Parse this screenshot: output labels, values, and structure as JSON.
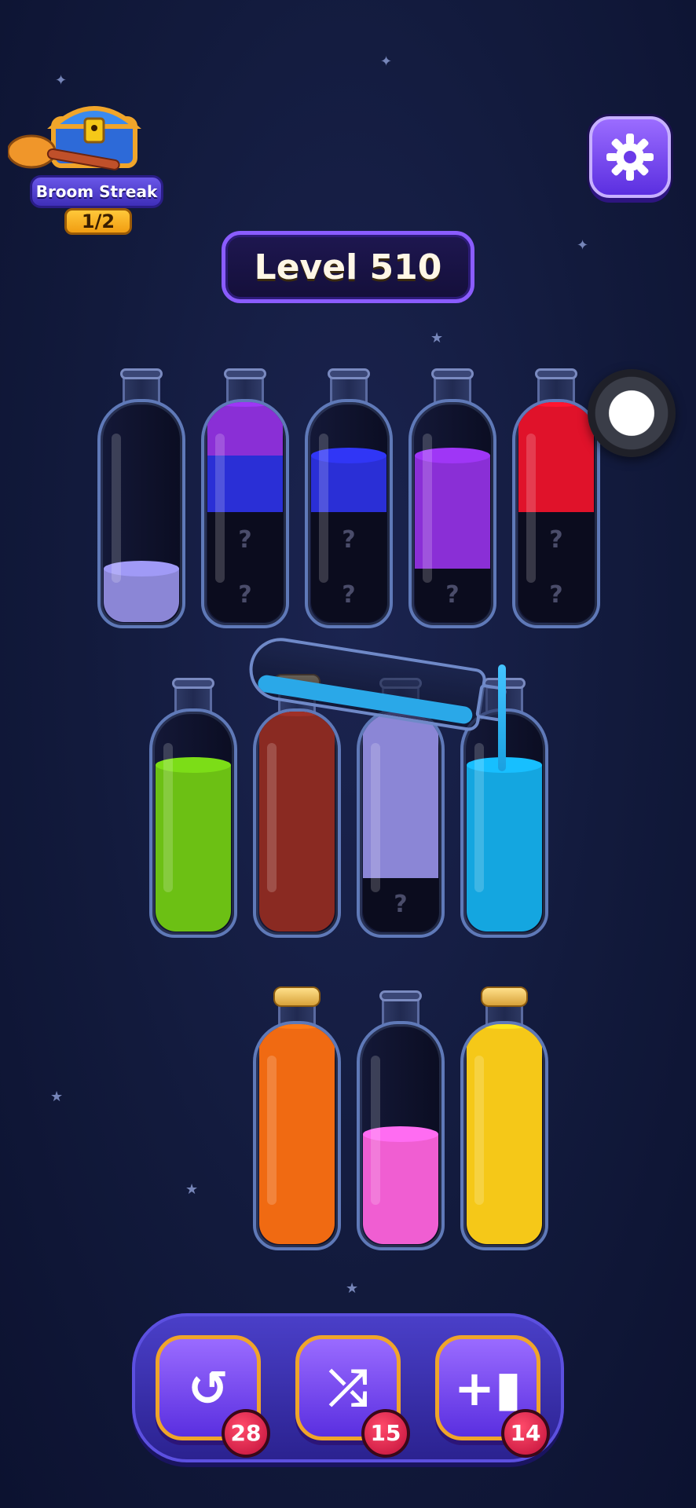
{
  "streak": {
    "label": "Broom Streak",
    "count": "1/2"
  },
  "level": {
    "label": "Level 510"
  },
  "hidden_marker": "?",
  "colors": {
    "lavender": "#8b86d6",
    "purple": "#8a2fd6",
    "blue": "#2a2fd6",
    "red": "#e0122a",
    "green": "#6cc014",
    "brown": "#8a2a22",
    "cyan": "#14a6e0",
    "orange": "#f06a12",
    "pink": "#f05ed2",
    "yellow": "#f5c818"
  },
  "bottles": [
    {
      "corked": false,
      "layers": [
        {
          "color": "lavender",
          "units": 1
        }
      ]
    },
    {
      "corked": false,
      "layers": [
        {
          "hidden": true
        },
        {
          "hidden": true
        },
        {
          "color": "blue",
          "units": 1
        },
        {
          "color": "purple",
          "units": 1
        }
      ]
    },
    {
      "corked": false,
      "layers": [
        {
          "hidden": true
        },
        {
          "hidden": true
        },
        {
          "color": "blue",
          "units": 1
        }
      ]
    },
    {
      "corked": false,
      "layers": [
        {
          "hidden": true
        },
        {
          "color": "purple",
          "units": 2
        }
      ]
    },
    {
      "corked": false,
      "layers": [
        {
          "hidden": true
        },
        {
          "hidden": true
        },
        {
          "color": "red",
          "units": 2
        }
      ]
    },
    {
      "corked": false,
      "layers": [
        {
          "color": "green",
          "units": 3
        }
      ]
    },
    {
      "corked": true,
      "layers": [
        {
          "color": "brown",
          "units": 4
        }
      ]
    },
    {
      "corked": false,
      "layers": [
        {
          "hidden": true
        },
        {
          "color": "lavender",
          "units": 3
        }
      ]
    },
    {
      "corked": false,
      "layers": [
        {
          "color": "cyan",
          "units": 3
        }
      ]
    },
    {
      "corked": true,
      "layers": [
        {
          "color": "orange",
          "units": 4
        }
      ]
    },
    {
      "corked": false,
      "layers": [
        {
          "color": "pink",
          "units": 2
        }
      ]
    },
    {
      "corked": true,
      "layers": [
        {
          "color": "yellow",
          "units": 4
        }
      ]
    }
  ],
  "powerups": [
    {
      "name": "undo",
      "icon": "undo-icon",
      "glyph": "↺",
      "count": "28"
    },
    {
      "name": "shuffle",
      "icon": "shuffle-icon",
      "glyph": "⤮",
      "count": "15"
    },
    {
      "name": "add-bottle",
      "icon": "add-bottle-icon",
      "glyph": "+▮",
      "count": "14"
    }
  ]
}
